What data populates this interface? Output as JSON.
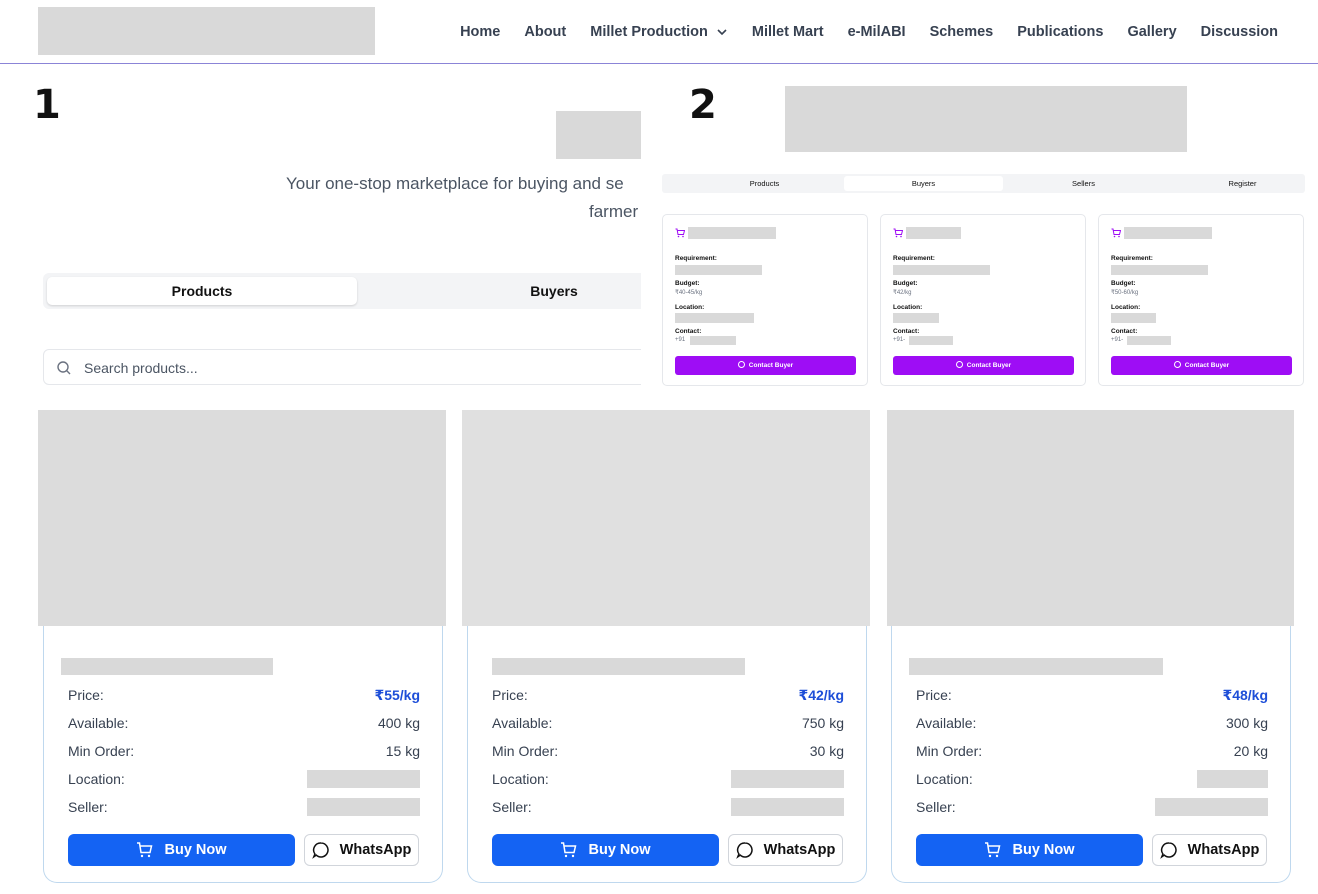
{
  "nav": {
    "items": [
      {
        "label": "Home"
      },
      {
        "label": "About"
      },
      {
        "label": "Millet Production",
        "dropdown": true
      },
      {
        "label": "Millet Mart"
      },
      {
        "label": "e-MilABI"
      },
      {
        "label": "Schemes"
      },
      {
        "label": "Publications"
      },
      {
        "label": "Gallery"
      },
      {
        "label": "Discussion"
      }
    ]
  },
  "panel1": {
    "number": "1",
    "tagline": "Your one-stop marketplace for buying and se",
    "tagline2": "farmer",
    "tabs": [
      "Products",
      "Buyers"
    ],
    "search_placeholder": "Search products..."
  },
  "panel2": {
    "number": "2",
    "tabs": [
      "Products",
      "Buyers",
      "Sellers",
      "Register"
    ],
    "active_tab": "Buyers",
    "buyers": [
      {
        "requirement_label": "Requirement:",
        "budget_label": "Budget:",
        "budget": "₹40-45/kg",
        "location_label": "Location:",
        "contact_label": "Contact:",
        "contact_prefix": "+91",
        "button": "Contact Buyer"
      },
      {
        "requirement_label": "Requirement:",
        "budget_label": "Budget:",
        "budget": "₹42/kg",
        "location_label": "Location:",
        "contact_label": "Contact:",
        "contact_prefix": "+91-",
        "button": "Contact Buyer"
      },
      {
        "requirement_label": "Requirement:",
        "budget_label": "Budget:",
        "budget": "₹50-60/kg",
        "location_label": "Location:",
        "contact_label": "Contact:",
        "contact_prefix": "+91-",
        "button": "Contact Buyer"
      }
    ]
  },
  "products": [
    {
      "price_label": "Price:",
      "price": "₹55/kg",
      "available_label": "Available:",
      "available": "400 kg",
      "min_label": "Min Order:",
      "min": "15 kg",
      "location_label": "Location:",
      "seller_label": "Seller:",
      "buy": "Buy Now",
      "whatsapp": "WhatsApp"
    },
    {
      "price_label": "Price:",
      "price": "₹42/kg",
      "available_label": "Available:",
      "available": "750 kg",
      "min_label": "Min Order:",
      "min": "30 kg",
      "location_label": "Location:",
      "seller_label": "Seller:",
      "buy": "Buy Now",
      "whatsapp": "WhatsApp"
    },
    {
      "price_label": "Price:",
      "price": "₹48/kg",
      "available_label": "Available:",
      "available": "300 kg",
      "min_label": "Min Order:",
      "min": "20 kg",
      "location_label": "Location:",
      "seller_label": "Seller:",
      "buy": "Buy Now",
      "whatsapp": "WhatsApp"
    }
  ],
  "colors": {
    "primary": "#1463f3",
    "buyer_accent": "#9e0df5",
    "price": "#1d4ed8",
    "nav_border": "#8b84d7"
  }
}
